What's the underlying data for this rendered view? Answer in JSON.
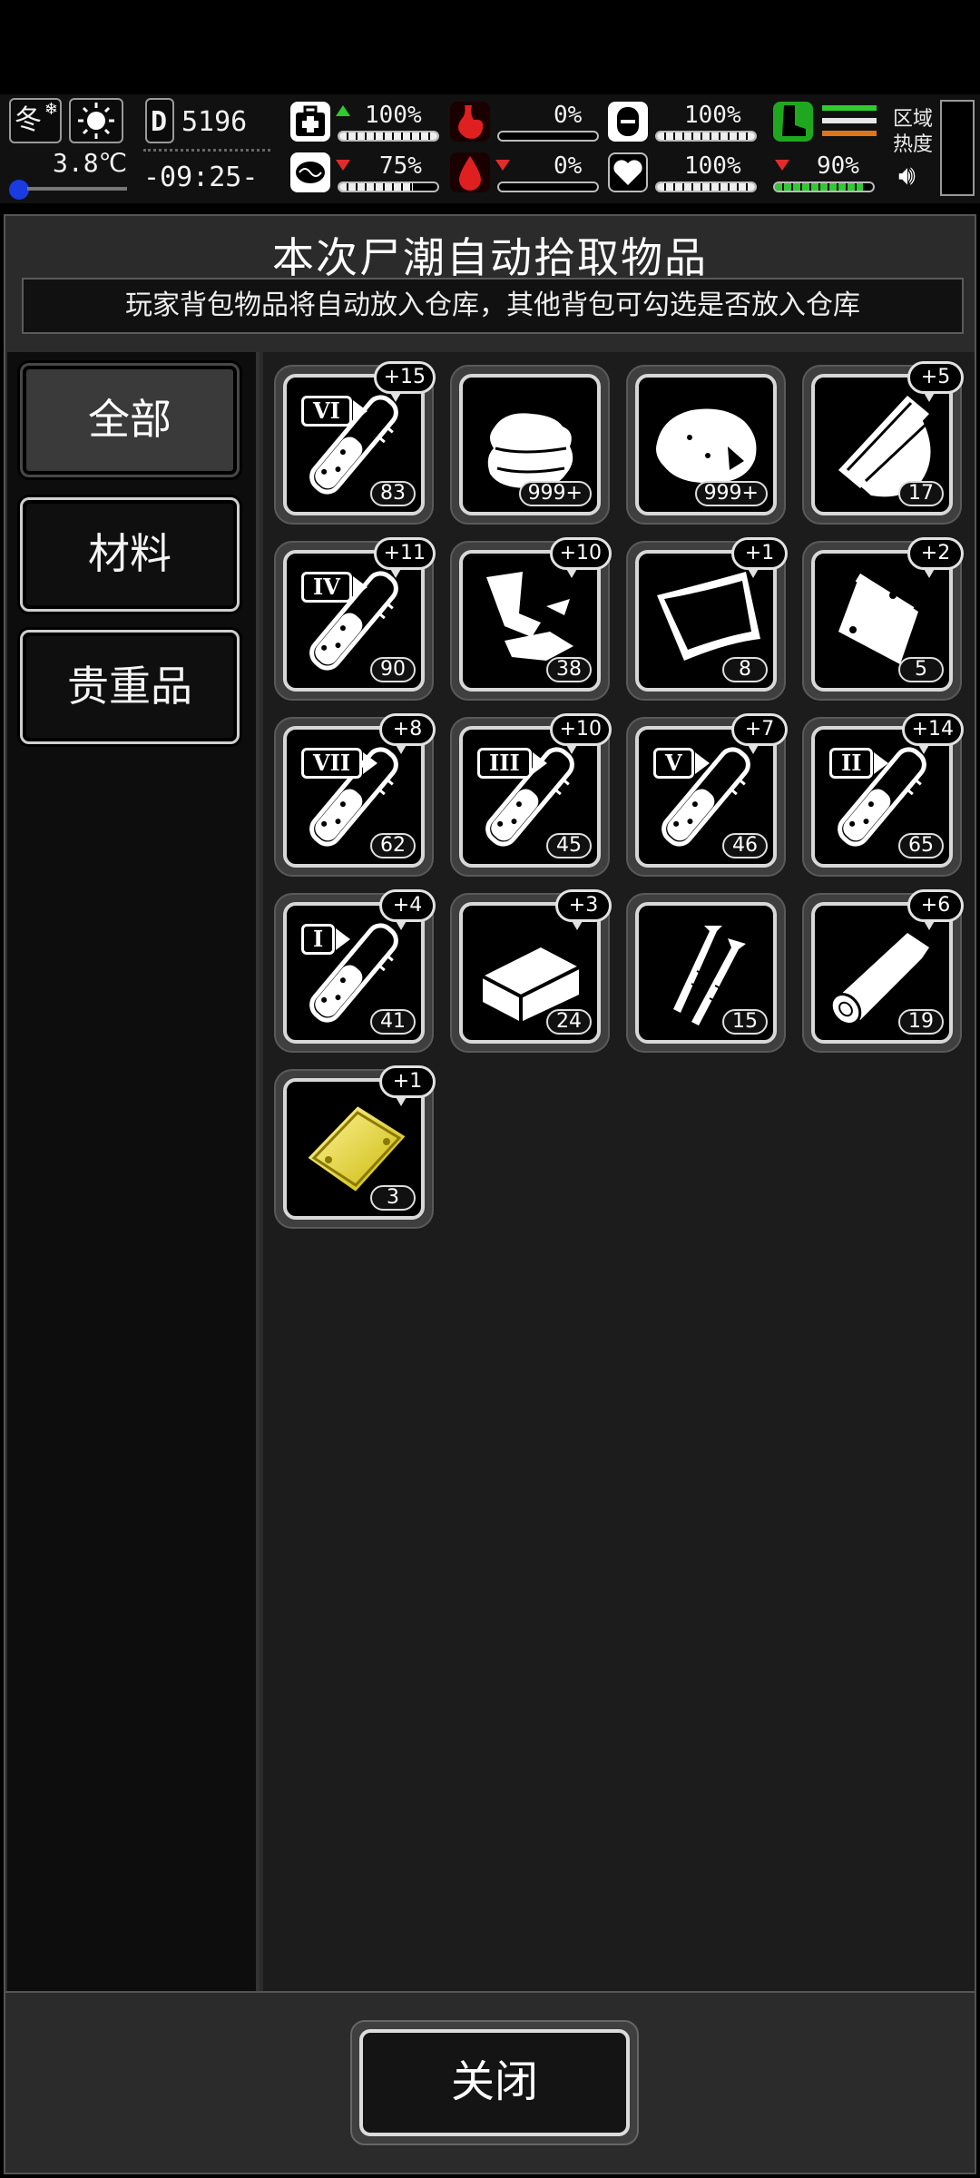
{
  "status_bar": {
    "season": "冬",
    "temperature": "3.8℃",
    "day": "5196",
    "day_prefix": "D",
    "time": "-09:25-",
    "health": {
      "value": "100%",
      "level": 1.0,
      "trend": "up"
    },
    "sanity": {
      "value": "75%",
      "level": 0.75,
      "trend": "down"
    },
    "hunger": {
      "value": "0%",
      "level": 0.0
    },
    "thirst": {
      "value": "0%",
      "level": 0.0,
      "trend": "down"
    },
    "shield": {
      "value": "100%",
      "level": 1.0
    },
    "heart": {
      "value": "100%",
      "level": 1.0
    },
    "stamina": {
      "value": "90%",
      "level": 0.9,
      "trend": "down"
    },
    "area_heat_label": "区域\n热度",
    "icons": {
      "season": "snow-icon",
      "weather": "sun-icon",
      "health": "medkit-icon",
      "sanity": "brain-icon",
      "hunger": "stomach-icon",
      "thirst": "blood-drop-icon",
      "shield": "shield-icon",
      "heart": "heart-icon",
      "stamina": "boot-icon",
      "sound": "speaker-icon"
    },
    "colors": {
      "up": "#2ecc2e",
      "down": "#e42b2b",
      "stamina": "#34c934",
      "hunger": "#e02020"
    }
  },
  "dialog": {
    "title": "本次尸潮自动拾取物品",
    "subtitle": "玩家背包物品将自动放入仓库，其他背包可勾选是否放入仓库",
    "tabs": [
      {
        "label": "全部",
        "active": true
      },
      {
        "label": "材料",
        "active": false
      },
      {
        "label": "贵重品",
        "active": false
      }
    ],
    "items": [
      {
        "icon": "test-tube-icon",
        "grade": "VI",
        "bonus": "+15",
        "count": "83"
      },
      {
        "icon": "cloth-icon",
        "grade": "",
        "bonus": "",
        "count": "999+"
      },
      {
        "icon": "rock-icon",
        "grade": "",
        "bonus": "",
        "count": "999+"
      },
      {
        "icon": "wood-planks-icon",
        "grade": "",
        "bonus": "+5",
        "count": "17"
      },
      {
        "icon": "test-tube-icon",
        "grade": "IV",
        "bonus": "+11",
        "count": "90"
      },
      {
        "icon": "scrap-metal-icon",
        "grade": "",
        "bonus": "+10",
        "count": "38"
      },
      {
        "icon": "sheet-metal-icon",
        "grade": "",
        "bonus": "+1",
        "count": "8"
      },
      {
        "icon": "plastic-bag-icon",
        "grade": "",
        "bonus": "+2",
        "count": "5"
      },
      {
        "icon": "test-tube-icon",
        "grade": "VII",
        "bonus": "+8",
        "count": "62"
      },
      {
        "icon": "test-tube-icon",
        "grade": "III",
        "bonus": "+10",
        "count": "45"
      },
      {
        "icon": "test-tube-icon",
        "grade": "V",
        "bonus": "+7",
        "count": "46"
      },
      {
        "icon": "test-tube-icon",
        "grade": "II",
        "bonus": "+14",
        "count": "65"
      },
      {
        "icon": "test-tube-icon",
        "grade": "I",
        "bonus": "+4",
        "count": "41"
      },
      {
        "icon": "brick-icon",
        "grade": "",
        "bonus": "+3",
        "count": "24"
      },
      {
        "icon": "nails-icon",
        "grade": "",
        "bonus": "",
        "count": "15"
      },
      {
        "icon": "log-icon",
        "grade": "",
        "bonus": "+6",
        "count": "19"
      },
      {
        "icon": "gold-bar-icon",
        "grade": "",
        "bonus": "+1",
        "count": "3"
      }
    ],
    "close_label": "关闭"
  }
}
